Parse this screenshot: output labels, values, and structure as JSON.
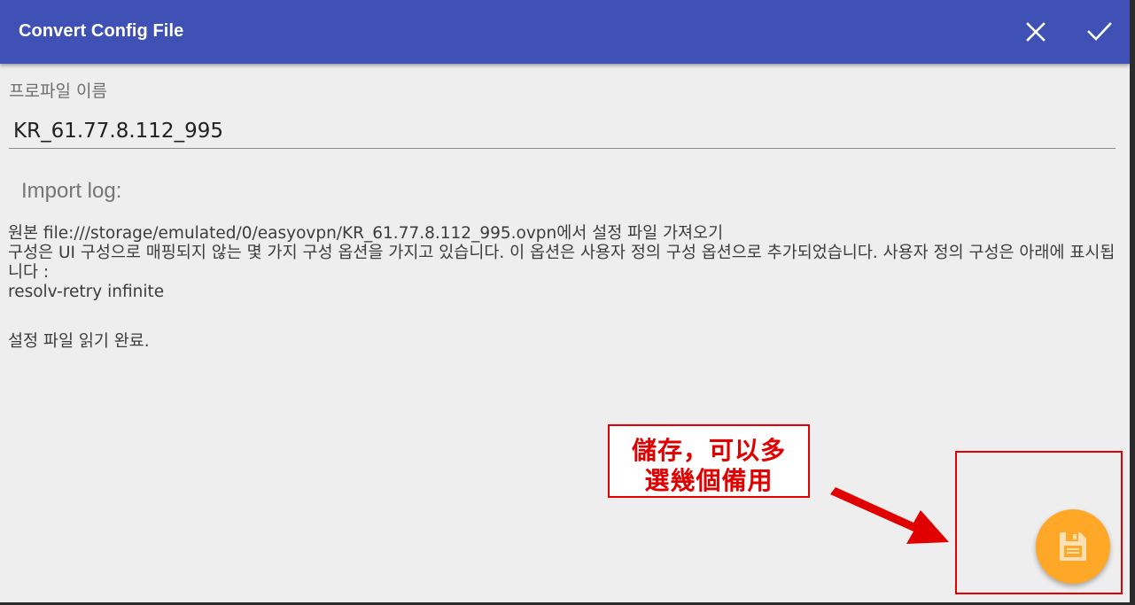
{
  "appbar": {
    "title": "Convert Config File",
    "cancel_icon": "close-icon",
    "confirm_icon": "check-icon",
    "color": "#3f51b5"
  },
  "form": {
    "profile_label": "프로파일 이름",
    "profile_name": "KR_61.77.8.112_995"
  },
  "log": {
    "heading": "Import log:",
    "lines": [
      "원본 file:///storage/emulated/0/easyovpn/KR_61.77.8.112_995.ovpn에서 설정 파일 가져오기",
      "구성은 UI 구성으로 매핑되지 않는 몇 가지 구성 옵션을 가지고 있습니다. 이 옵션은 사용자 정의 구성 옵션으로 추가되었습니다. 사용자 정의 구성은 아래에 표시됩니다 :",
      "resolv-retry infinite",
      "설정 파일 읽기 완료."
    ]
  },
  "annotation": {
    "line1": "儲存，可以多",
    "line2": "選幾個備用",
    "color": "#e00000"
  },
  "fab": {
    "icon": "save-icon",
    "color": "#ffa726"
  }
}
